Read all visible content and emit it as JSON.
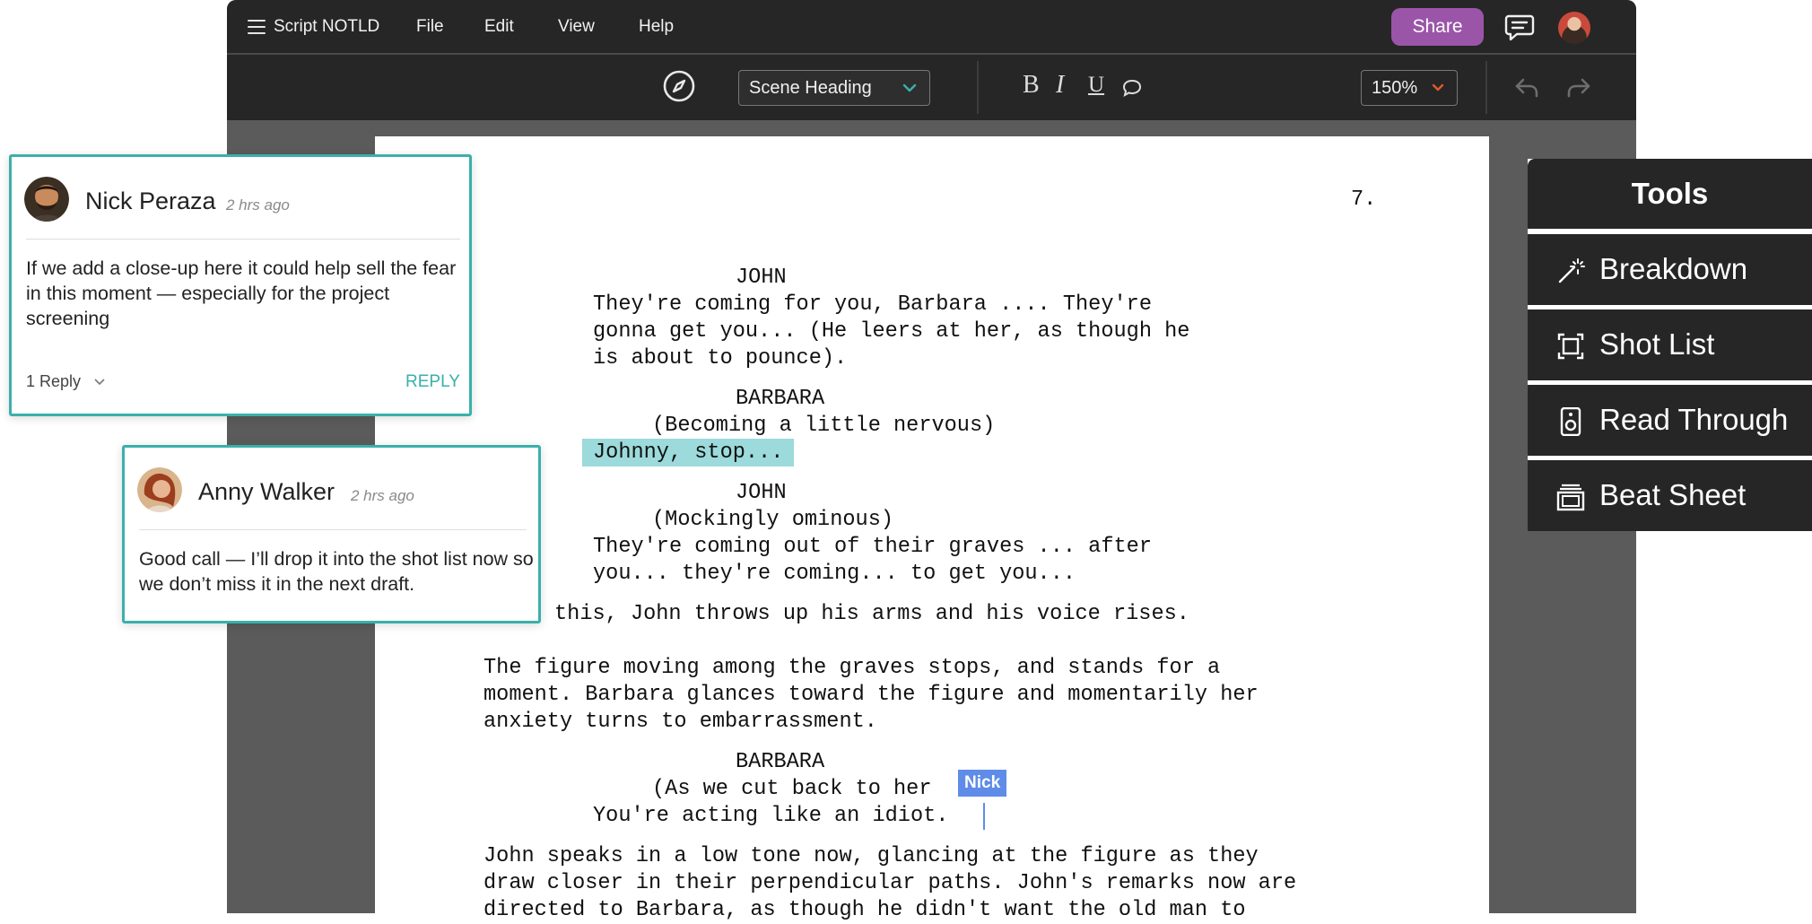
{
  "menubar": {
    "doc_title": "Script NOTLD",
    "menu": [
      "File",
      "Edit",
      "View",
      "Help"
    ],
    "share_label": "Share"
  },
  "toolbar": {
    "element_style": "Scene Heading",
    "format_buttons": {
      "bold": "B",
      "italic": "I",
      "underline": "U"
    },
    "zoom": "150%"
  },
  "script": {
    "page_number": "7.",
    "lines": [
      "JOHN",
      "They're coming for you, Barbara .... They're",
      "gonna get you... (He leers at her, as though he",
      "is about to pounce).",
      "BARBARA",
      "(Becoming a little nervous)",
      "Johnny, stop...",
      "JOHN",
      "(Mockingly ominous)",
      "They're coming out of their graves ... after",
      "you... they're coming... to get you...",
      "this, John throws up his arms and his voice rises.",
      "The figure moving among the graves stops, and stands for a",
      "moment. Barbara glances toward the figure and momentarily her",
      "anxiety turns to embarrassment.",
      "BARBARA",
      "(As we cut back to her",
      "You're acting like an idiot.",
      "John speaks in a low tone now, glancing at the figure as they",
      "draw closer in their perpendicular paths. John's remarks now are",
      "directed to Barbara, as though he didn't want the old man to"
    ],
    "collaborator_cursor": "Nick"
  },
  "tools": {
    "title": "Tools",
    "items": [
      {
        "label": "Breakdown",
        "icon": "magic-wand-icon"
      },
      {
        "label": "Shot List",
        "icon": "frame-icon"
      },
      {
        "label": "Read Through",
        "icon": "speaker-icon"
      },
      {
        "label": "Beat Sheet",
        "icon": "cards-icon"
      }
    ]
  },
  "comments": [
    {
      "author": "Nick Peraza",
      "time": "2 hrs ago",
      "text": "If we add a close-up here it could help sell the fear in this moment — especially for the project screening",
      "reply_count": "1 Reply",
      "reply_label": "REPLY"
    },
    {
      "author": "Anny Walker",
      "time": "2 hrs ago",
      "text": "Good call — I’ll drop it into the shot list now so we don’t miss it in the next draft."
    }
  ],
  "colors": {
    "accent_teal": "#3ab0ab",
    "share_purple": "#9a55a8",
    "highlight": "#9cdadb",
    "cursor_blue": "#5f8ce8",
    "chrome_dark": "#262626"
  }
}
